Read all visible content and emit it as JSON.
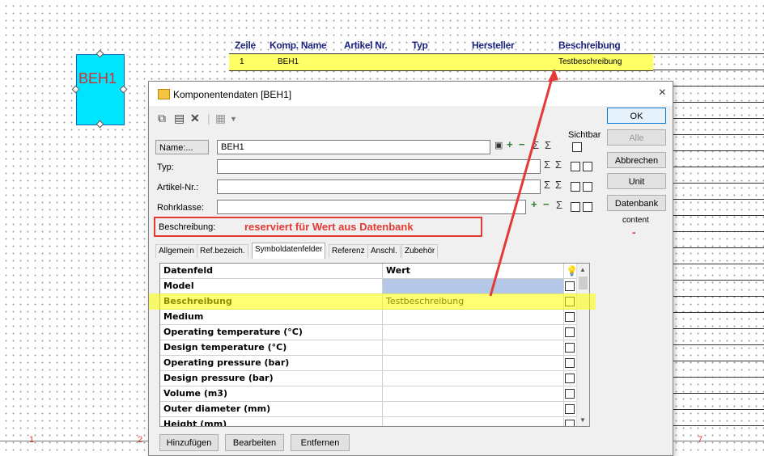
{
  "schematic": {
    "component_label": "BEH1",
    "headers": [
      "Zeile",
      "Komp. Name",
      "Artikel Nr.",
      "Typ",
      "Hersteller",
      "Beschreibung"
    ],
    "row": {
      "zeile": "1",
      "name": "BEH1",
      "beschreibung": "Testbeschreibung"
    },
    "ruler": [
      "1",
      "2",
      "7"
    ]
  },
  "dialog": {
    "title": "Komponentendaten [BEH1]",
    "close": "×",
    "sichtbar": "Sichtbar",
    "name_label": "Name:...",
    "name_value": "BEH1",
    "typ_label": "Typ:",
    "artikel_label": "Artikel-Nr.:",
    "rohrklasse_label": "Rohrklasse:",
    "beschreibung_label": "Beschreibung:",
    "annotation": "reserviert für Wert aus Datenbank",
    "buttons": {
      "ok": "OK",
      "alle": "Alle",
      "abbrechen": "Abbrechen",
      "unit": "Unit",
      "datenbank": "Datenbank"
    },
    "content_label": "content",
    "content_dash": "-",
    "tabs": [
      "Allgemein",
      "Ref.bezeich.",
      "Symboldatenfelder",
      "Referenz",
      "Anschl.",
      "Zubehör"
    ],
    "grid": {
      "headers": {
        "col1": "Datenfeld",
        "col2": "Wert"
      },
      "rows": [
        {
          "field": "Model",
          "value": ""
        },
        {
          "field": "Beschreibung",
          "value": "Testbeschreibung"
        },
        {
          "field": "Medium",
          "value": ""
        },
        {
          "field": "Operating temperature (°C)",
          "value": ""
        },
        {
          "field": "Design temperature (°C)",
          "value": ""
        },
        {
          "field": "Operating pressure (bar)",
          "value": ""
        },
        {
          "field": "Design pressure (bar)",
          "value": ""
        },
        {
          "field": "Volume (m3)",
          "value": ""
        },
        {
          "field": "Outer diameter (mm)",
          "value": ""
        },
        {
          "field": "Height (mm)",
          "value": ""
        }
      ]
    },
    "bottom": {
      "add": "Hinzufügen",
      "edit": "Bearbeiten",
      "remove": "Entfernen"
    },
    "sigma": "Σ"
  },
  "colors": {
    "highlight": "#ffff66",
    "annotation": "#e53935",
    "component": "#00e5ff"
  }
}
